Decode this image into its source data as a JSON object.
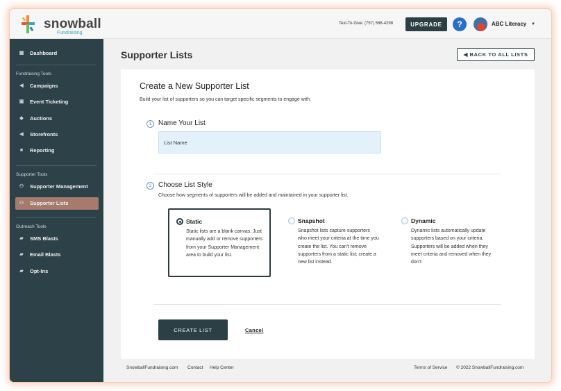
{
  "header": {
    "logo_word": "snowball",
    "logo_sub": "Fundraising",
    "text_to_give": "Text-To-Give: (757) 586-4298",
    "upgrade_label": "UPGRADE",
    "help_label": "?",
    "org_name": "ABC Literacy",
    "org_caret": "▼"
  },
  "sidebar": {
    "dashboard": "Dashboard",
    "fundraising_head": "Fundraising Tools",
    "fundraising": [
      "Campaigns",
      "Event Ticketing",
      "Auctions",
      "Storefronts",
      "Reporting"
    ],
    "supporter_head": "Supporter Tools",
    "supporter": [
      "Supporter Management",
      "Supporter Lists"
    ],
    "outreach_head": "Outreach Tools",
    "outreach": [
      "SMS Blasts",
      "Email Blasts",
      "Opt-Ins"
    ]
  },
  "page": {
    "title": "Supporter Lists",
    "back_label": "◀ BACK TO ALL LISTS"
  },
  "card": {
    "title": "Create a New Supporter List",
    "subtitle": "Build your list of supporters so you can target specific segments to engage with.",
    "step1_num": "1",
    "step1_title": "Name Your List",
    "list_name_placeholder": "List Name",
    "step2_num": "2",
    "step2_title": "Choose List Style",
    "step2_desc": "Choose how segments of supporters will be added and maintained in your supporter list.",
    "options": [
      {
        "title": "Static",
        "body": "Static lists are a blank canvas. Just manually add or remove supporters from your Supporter Management area to build your list.",
        "selected": true
      },
      {
        "title": "Snapshot",
        "body": "Snapshot lists capture supporters who meet your criteria at the time you create the list. You can't remove supporters from a static list; create a new list instead.",
        "selected": false
      },
      {
        "title": "Dynamic",
        "body": "Dynamic lists automatically update supporters based on your criteria. Supporters will be added when they meet criteria and removed when they don't.",
        "selected": false
      }
    ],
    "create_label": "CREATE LIST",
    "cancel_label": "Cancel"
  },
  "footer": {
    "site": "SnowballFundraising.com",
    "contact": "Contact",
    "help": "Help Center",
    "terms": "Terms of Service",
    "copyright": "© 2022 SnowballFundraising.com"
  },
  "colors": {
    "sidebar_bg": "#2d4248",
    "active_item": "#a77a6e",
    "primary_button": "#2b3f45",
    "help_blue": "#2a6fc7"
  }
}
